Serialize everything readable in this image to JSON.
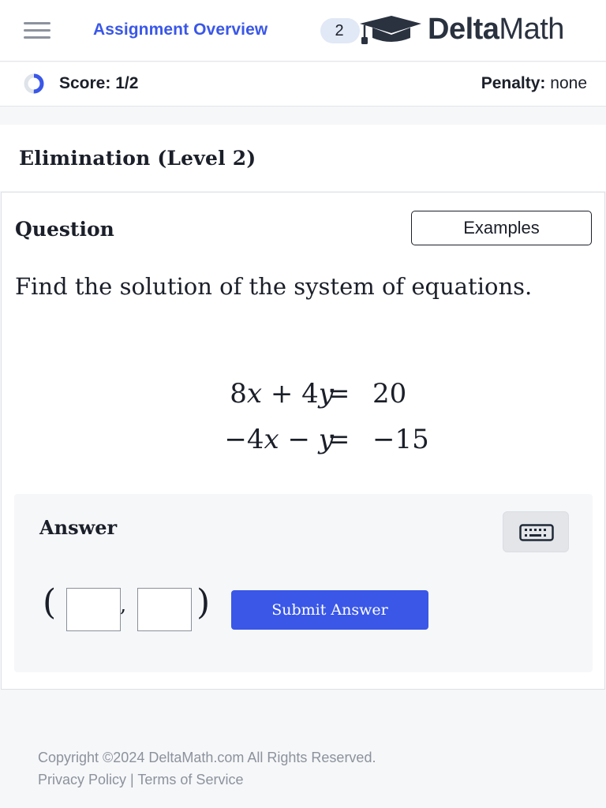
{
  "header": {
    "menu_icon": "hamburger-icon",
    "overview_link": "Assignment Overview",
    "count_badge": "2",
    "logo_icon": "graduation-cap-icon",
    "logo_bold": "Delta",
    "logo_rest": "Math"
  },
  "scorebar": {
    "progress_icon": "progress-ring-icon",
    "score": "Score: 1/2",
    "progress_fraction": 0.5,
    "penalty_label": "Penalty:",
    "penalty_value": "none"
  },
  "skill_title": "Elimination (Level 2)",
  "question": {
    "label": "Question",
    "examples_button": "Examples",
    "prompt": "Find the solution of the system of equations.",
    "equations": [
      {
        "lhs_coef1": "8",
        "var1": "x",
        "op": "+",
        "lhs_coef2": "4",
        "var2": "y",
        "eq": "=",
        "rhs": "20"
      },
      {
        "lhs_coef1": "−4",
        "var1": "x",
        "op": "−",
        "lhs_coef2": "",
        "var2": "y",
        "eq": "=",
        "rhs": "−15"
      }
    ]
  },
  "answer": {
    "label": "Answer",
    "keyboard_icon": "keyboard-icon",
    "open_paren": "(",
    "comma": ",",
    "close_paren": ")",
    "x_value": "",
    "y_value": "",
    "submit_button": "Submit Answer"
  },
  "footer": {
    "copyright": "Copyright ©2024 DeltaMath.com All Rights Reserved.",
    "privacy": "Privacy Policy",
    "separator": "|",
    "terms": "Terms of Service"
  },
  "colors": {
    "accent": "#3a57e8",
    "badge_bg": "#e1e8f6",
    "text": "#1b1f29",
    "muted": "#8c929c"
  }
}
